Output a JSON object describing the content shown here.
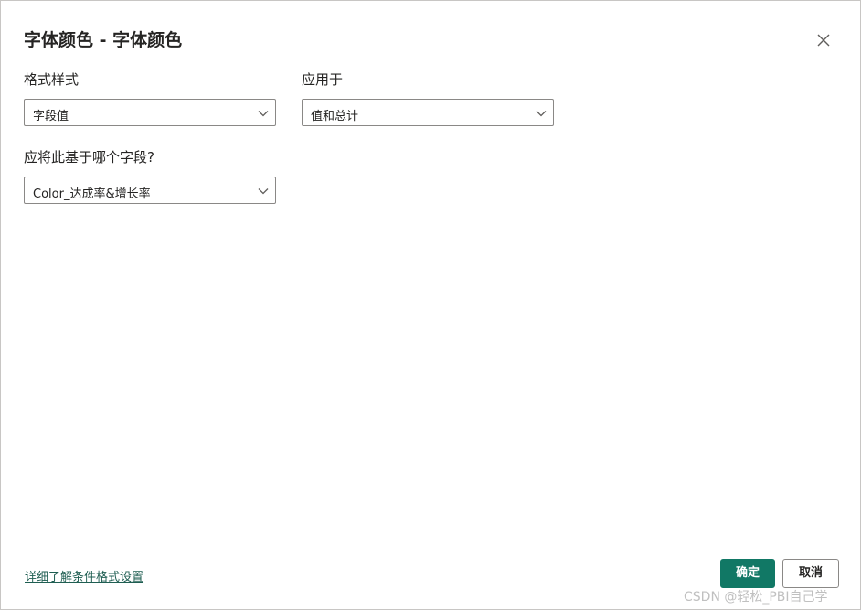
{
  "dialog": {
    "title": "字体颜色 - 字体颜色",
    "close_icon": "close-icon"
  },
  "format_style": {
    "label": "格式样式",
    "value": "字段值"
  },
  "apply_to": {
    "label": "应用于",
    "value": "值和总计"
  },
  "base_field": {
    "label": "应将此基于哪个字段?",
    "value": "Color_达成率&增长率"
  },
  "footer": {
    "learn_more_link": "详细了解条件格式设置",
    "ok_label": "确定",
    "cancel_label": "取消"
  },
  "watermark": "CSDN @轻松_PBI自己学",
  "colors": {
    "primary": "#117865",
    "link": "#1f5e52",
    "border": "#8a8886"
  }
}
